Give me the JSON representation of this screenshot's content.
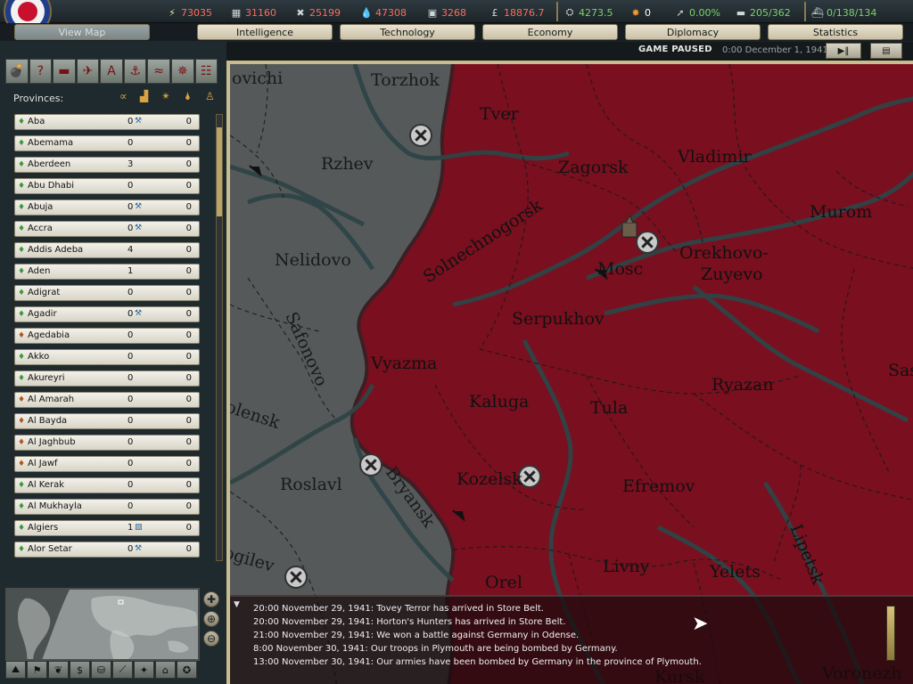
{
  "resources": [
    {
      "icon": "energy-icon",
      "glyph": "⚡",
      "value": "73035"
    },
    {
      "icon": "metal-icon",
      "glyph": "▦",
      "value": "31160"
    },
    {
      "icon": "rare-materials-icon",
      "glyph": "✖",
      "value": "25199"
    },
    {
      "icon": "oil-icon",
      "glyph": "💧",
      "value": "47308"
    },
    {
      "icon": "supplies-icon",
      "glyph": "▣",
      "value": "3268"
    },
    {
      "icon": "money-icon",
      "glyph": "£",
      "value": "18876.7"
    }
  ],
  "stats": [
    {
      "icon": "ic-icon",
      "glyph": "⛭",
      "value": "4273.5"
    },
    {
      "icon": "nuke-icon",
      "glyph": "✸",
      "value": "0"
    },
    {
      "icon": "rocket-icon",
      "glyph": "➚",
      "value": "0.00%"
    },
    {
      "icon": "transport-icon",
      "glyph": "▬",
      "value": "205/362"
    },
    {
      "icon": "convoy-icon",
      "glyph": "⛴",
      "value": "0/138/134"
    }
  ],
  "tabs": {
    "view_map": "View Map",
    "intelligence": "Intelligence",
    "technology": "Technology",
    "economy": "Economy",
    "diplomacy": "Diplomacy",
    "statistics": "Statistics"
  },
  "status": {
    "paused": "GAME PAUSED",
    "datetime": "0:00 December 1, 1941",
    "play_pause": "▶‖",
    "menu": "▤"
  },
  "toolbar": [
    "💣",
    "?",
    "▬",
    "✈",
    "A",
    "⚓",
    "≈",
    "✵",
    "☷"
  ],
  "provinces": {
    "title": "Provinces:",
    "header_icons": [
      "∝",
      "▟",
      "✴",
      "🌢",
      "♙"
    ],
    "rows": [
      {
        "name": "Aba",
        "v1": "0",
        "mark": "⚒",
        "v2": "0",
        "color": "#3a9a3a"
      },
      {
        "name": "Abemama",
        "v1": "0",
        "mark": "",
        "v2": "0",
        "color": "#3a9a3a"
      },
      {
        "name": "Aberdeen",
        "v1": "3",
        "mark": "",
        "v2": "0",
        "color": "#3a9a3a"
      },
      {
        "name": "Abu Dhabi",
        "v1": "0",
        "mark": "",
        "v2": "0",
        "color": "#3a9a3a"
      },
      {
        "name": "Abuja",
        "v1": "0",
        "mark": "⚒",
        "v2": "0",
        "color": "#3a9a3a"
      },
      {
        "name": "Accra",
        "v1": "0",
        "mark": "⚒",
        "v2": "0",
        "color": "#3a9a3a"
      },
      {
        "name": "Addis Adeba",
        "v1": "4",
        "mark": "",
        "v2": "0",
        "color": "#3a9a3a"
      },
      {
        "name": "Aden",
        "v1": "1",
        "mark": "",
        "v2": "0",
        "color": "#3a9a3a"
      },
      {
        "name": "Adigrat",
        "v1": "0",
        "mark": "",
        "v2": "0",
        "color": "#3a9a3a"
      },
      {
        "name": "Agadir",
        "v1": "0",
        "mark": "⚒",
        "v2": "0",
        "color": "#3a9a3a"
      },
      {
        "name": "Agedabia",
        "v1": "0",
        "mark": "",
        "v2": "0",
        "color": "#b5541c"
      },
      {
        "name": "Akko",
        "v1": "0",
        "mark": "",
        "v2": "0",
        "color": "#3a9a3a"
      },
      {
        "name": "Akureyri",
        "v1": "0",
        "mark": "",
        "v2": "0",
        "color": "#3a9a3a"
      },
      {
        "name": "Al Amarah",
        "v1": "0",
        "mark": "",
        "v2": "0",
        "color": "#b5541c"
      },
      {
        "name": "Al Bayda",
        "v1": "0",
        "mark": "",
        "v2": "0",
        "color": "#b5541c"
      },
      {
        "name": "Al Jaghbub",
        "v1": "0",
        "mark": "",
        "v2": "0",
        "color": "#b5541c"
      },
      {
        "name": "Al Jawf",
        "v1": "0",
        "mark": "",
        "v2": "0",
        "color": "#b5541c"
      },
      {
        "name": "Al Kerak",
        "v1": "0",
        "mark": "",
        "v2": "0",
        "color": "#3a9a3a"
      },
      {
        "name": "Al Mukhayla",
        "v1": "0",
        "mark": "",
        "v2": "0",
        "color": "#3a9a3a"
      },
      {
        "name": "Algiers",
        "v1": "1",
        "mark": "▧",
        "v2": "0",
        "color": "#3a9a3a"
      },
      {
        "name": "Alor Setar",
        "v1": "0",
        "mark": "⚒",
        "v2": "0",
        "color": "#3a9a3a"
      }
    ]
  },
  "minimap_buttons": [
    "✚",
    "⊕",
    "⊖"
  ],
  "bottom_tools": [
    "⛰",
    "⚑",
    "❦",
    "$",
    "⛁",
    "⟋",
    "✦",
    "⌂",
    "✪"
  ],
  "map": {
    "cities_red": [
      "Tver",
      "Zagorsk",
      "Vladimir",
      "Murom",
      "Orekhovo-",
      "Zuyevo",
      "Serpukhov",
      "Vyazma",
      "Kaluga",
      "Tula",
      "Ryazan",
      "Kozelsk",
      "Efremov",
      "Orel",
      "Livny",
      "Yelets",
      "Lipetsk",
      "Saso",
      "Voronezh",
      "Kursk",
      "Solnechnogorsk",
      "Mosc"
    ],
    "cities_grey": [
      "Torzhok",
      "ovichi",
      "Rzhev",
      "Nelidovo",
      "Safonovo",
      "olensk",
      "Roslavl",
      "Bryansk",
      "ogilev"
    ]
  },
  "log": [
    "20:00 November 29, 1941: Tovey Terror has arrived in Store Belt.",
    "20:00 November 29, 1941: Horton's Hunters has arrived in Store Belt.",
    "21:00 November 29, 1941: We won a battle against Germany in Odense.",
    "8:00 November 30, 1941: Our troops in Plymouth are being bombed by Germany.",
    "13:00 November 30, 1941: Our armies have been bombed by Germany in the province of Plymouth."
  ]
}
